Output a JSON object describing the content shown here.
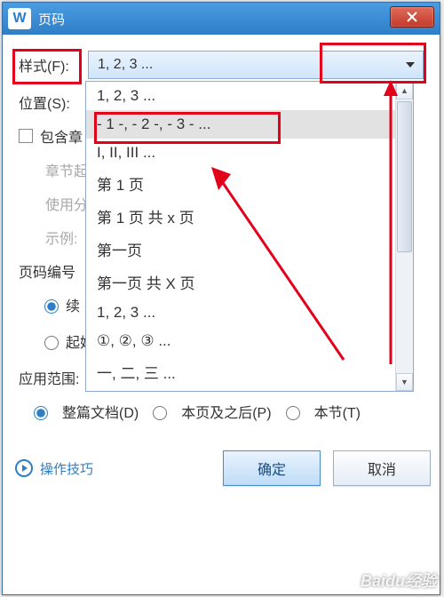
{
  "title": "页码",
  "app_glyph": "W",
  "labels": {
    "style": "样式(F):",
    "position": "位置(S):",
    "include_chapter": "包含章",
    "chapter_start": "章节起",
    "use_sep": "使用分",
    "example": "示例:",
    "numbering": "页码编号",
    "continue": "续",
    "start_at": "起始页码(A):",
    "apply": "应用范围:",
    "whole_doc": "整篇文档(D)",
    "after_page": "本页及之后(P)",
    "this_section": "本节(T)",
    "tips": "操作技巧",
    "ok": "确定",
    "cancel": "取消"
  },
  "style_selected": "1, 2, 3 ...",
  "dropdown_items": [
    "1, 2, 3 ...",
    "- 1 -, - 2 -, - 3 - ...",
    "I, II, III ...",
    "第 1 页",
    "第 1 页 共 x 页",
    "第一页",
    "第一页 共 X 页",
    "1, 2, 3 ...",
    "①, ②, ③ ...",
    "一, 二, 三 ..."
  ],
  "watermark": "Baidu经验"
}
